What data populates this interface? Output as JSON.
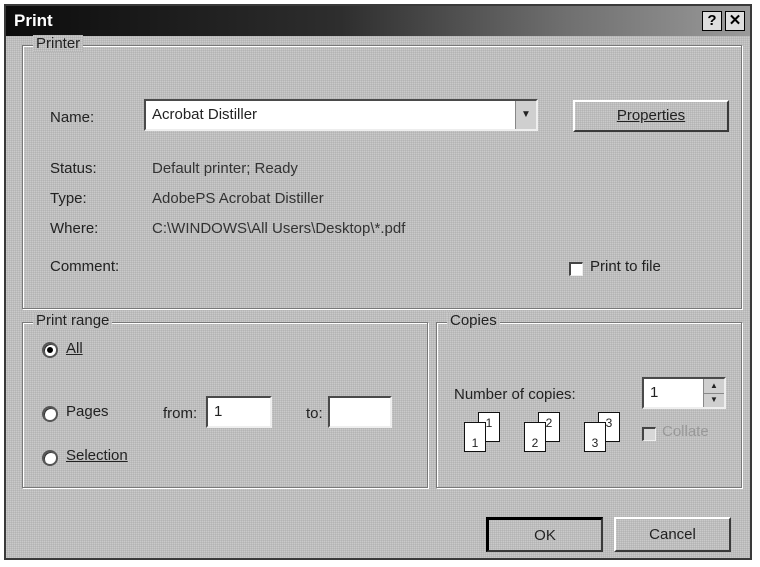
{
  "window": {
    "title": "Print",
    "help_glyph": "?",
    "close_glyph": "✕"
  },
  "printer_group": {
    "legend": "Printer",
    "name_label": "Name:",
    "name_value": "Acrobat Distiller",
    "properties_label": "Properties",
    "status_label": "Status:",
    "status_value": "Default printer; Ready",
    "type_label": "Type:",
    "type_value": "AdobePS Acrobat Distiller",
    "where_label": "Where:",
    "where_value": "C:\\WINDOWS\\All Users\\Desktop\\*.pdf",
    "comment_label": "Comment:",
    "print_to_file_label": "Print to file",
    "print_to_file_checked": false
  },
  "range_group": {
    "legend": "Print range",
    "all_label": "All",
    "pages_label": "Pages",
    "from_label": "from:",
    "from_value": "1",
    "to_label": "to:",
    "to_value": "",
    "selection_label": "Selection",
    "selected": "All"
  },
  "copies_group": {
    "legend": "Copies",
    "number_label": "Number of copies:",
    "number_value": "1",
    "collate_label": "Collate",
    "collate_checked": false,
    "collate_enabled": false,
    "page_numbers": [
      "1",
      "1",
      "2",
      "2",
      "3",
      "3"
    ]
  },
  "buttons": {
    "ok": "OK",
    "cancel": "Cancel"
  },
  "icons": {
    "dropdown": "▼",
    "spin_up": "▲",
    "spin_down": "▼"
  }
}
